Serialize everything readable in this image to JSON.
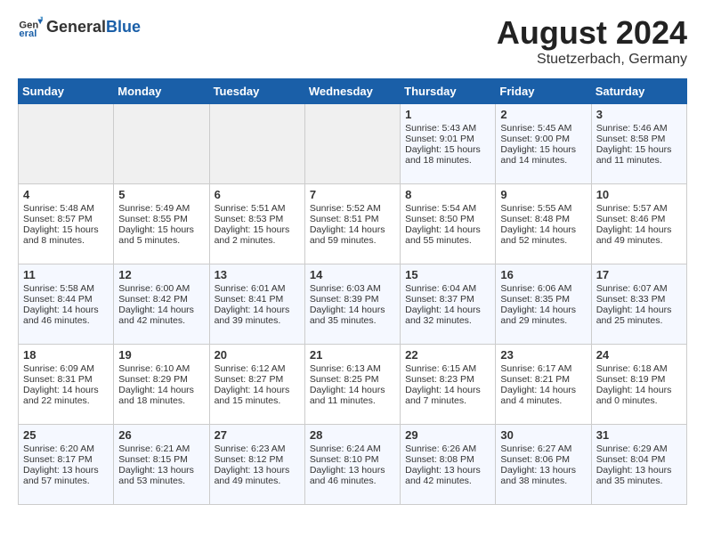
{
  "logo": {
    "text_general": "General",
    "text_blue": "Blue"
  },
  "title": "August 2024",
  "subtitle": "Stuetzerbach, Germany",
  "days_of_week": [
    "Sunday",
    "Monday",
    "Tuesday",
    "Wednesday",
    "Thursday",
    "Friday",
    "Saturday"
  ],
  "weeks": [
    [
      {
        "day": "",
        "content": ""
      },
      {
        "day": "",
        "content": ""
      },
      {
        "day": "",
        "content": ""
      },
      {
        "day": "",
        "content": ""
      },
      {
        "day": "1",
        "content": "Sunrise: 5:43 AM\nSunset: 9:01 PM\nDaylight: 15 hours and 18 minutes."
      },
      {
        "day": "2",
        "content": "Sunrise: 5:45 AM\nSunset: 9:00 PM\nDaylight: 15 hours and 14 minutes."
      },
      {
        "day": "3",
        "content": "Sunrise: 5:46 AM\nSunset: 8:58 PM\nDaylight: 15 hours and 11 minutes."
      }
    ],
    [
      {
        "day": "4",
        "content": "Sunrise: 5:48 AM\nSunset: 8:57 PM\nDaylight: 15 hours and 8 minutes."
      },
      {
        "day": "5",
        "content": "Sunrise: 5:49 AM\nSunset: 8:55 PM\nDaylight: 15 hours and 5 minutes."
      },
      {
        "day": "6",
        "content": "Sunrise: 5:51 AM\nSunset: 8:53 PM\nDaylight: 15 hours and 2 minutes."
      },
      {
        "day": "7",
        "content": "Sunrise: 5:52 AM\nSunset: 8:51 PM\nDaylight: 14 hours and 59 minutes."
      },
      {
        "day": "8",
        "content": "Sunrise: 5:54 AM\nSunset: 8:50 PM\nDaylight: 14 hours and 55 minutes."
      },
      {
        "day": "9",
        "content": "Sunrise: 5:55 AM\nSunset: 8:48 PM\nDaylight: 14 hours and 52 minutes."
      },
      {
        "day": "10",
        "content": "Sunrise: 5:57 AM\nSunset: 8:46 PM\nDaylight: 14 hours and 49 minutes."
      }
    ],
    [
      {
        "day": "11",
        "content": "Sunrise: 5:58 AM\nSunset: 8:44 PM\nDaylight: 14 hours and 46 minutes."
      },
      {
        "day": "12",
        "content": "Sunrise: 6:00 AM\nSunset: 8:42 PM\nDaylight: 14 hours and 42 minutes."
      },
      {
        "day": "13",
        "content": "Sunrise: 6:01 AM\nSunset: 8:41 PM\nDaylight: 14 hours and 39 minutes."
      },
      {
        "day": "14",
        "content": "Sunrise: 6:03 AM\nSunset: 8:39 PM\nDaylight: 14 hours and 35 minutes."
      },
      {
        "day": "15",
        "content": "Sunrise: 6:04 AM\nSunset: 8:37 PM\nDaylight: 14 hours and 32 minutes."
      },
      {
        "day": "16",
        "content": "Sunrise: 6:06 AM\nSunset: 8:35 PM\nDaylight: 14 hours and 29 minutes."
      },
      {
        "day": "17",
        "content": "Sunrise: 6:07 AM\nSunset: 8:33 PM\nDaylight: 14 hours and 25 minutes."
      }
    ],
    [
      {
        "day": "18",
        "content": "Sunrise: 6:09 AM\nSunset: 8:31 PM\nDaylight: 14 hours and 22 minutes."
      },
      {
        "day": "19",
        "content": "Sunrise: 6:10 AM\nSunset: 8:29 PM\nDaylight: 14 hours and 18 minutes."
      },
      {
        "day": "20",
        "content": "Sunrise: 6:12 AM\nSunset: 8:27 PM\nDaylight: 14 hours and 15 minutes."
      },
      {
        "day": "21",
        "content": "Sunrise: 6:13 AM\nSunset: 8:25 PM\nDaylight: 14 hours and 11 minutes."
      },
      {
        "day": "22",
        "content": "Sunrise: 6:15 AM\nSunset: 8:23 PM\nDaylight: 14 hours and 7 minutes."
      },
      {
        "day": "23",
        "content": "Sunrise: 6:17 AM\nSunset: 8:21 PM\nDaylight: 14 hours and 4 minutes."
      },
      {
        "day": "24",
        "content": "Sunrise: 6:18 AM\nSunset: 8:19 PM\nDaylight: 14 hours and 0 minutes."
      }
    ],
    [
      {
        "day": "25",
        "content": "Sunrise: 6:20 AM\nSunset: 8:17 PM\nDaylight: 13 hours and 57 minutes."
      },
      {
        "day": "26",
        "content": "Sunrise: 6:21 AM\nSunset: 8:15 PM\nDaylight: 13 hours and 53 minutes."
      },
      {
        "day": "27",
        "content": "Sunrise: 6:23 AM\nSunset: 8:12 PM\nDaylight: 13 hours and 49 minutes."
      },
      {
        "day": "28",
        "content": "Sunrise: 6:24 AM\nSunset: 8:10 PM\nDaylight: 13 hours and 46 minutes."
      },
      {
        "day": "29",
        "content": "Sunrise: 6:26 AM\nSunset: 8:08 PM\nDaylight: 13 hours and 42 minutes."
      },
      {
        "day": "30",
        "content": "Sunrise: 6:27 AM\nSunset: 8:06 PM\nDaylight: 13 hours and 38 minutes."
      },
      {
        "day": "31",
        "content": "Sunrise: 6:29 AM\nSunset: 8:04 PM\nDaylight: 13 hours and 35 minutes."
      }
    ]
  ]
}
